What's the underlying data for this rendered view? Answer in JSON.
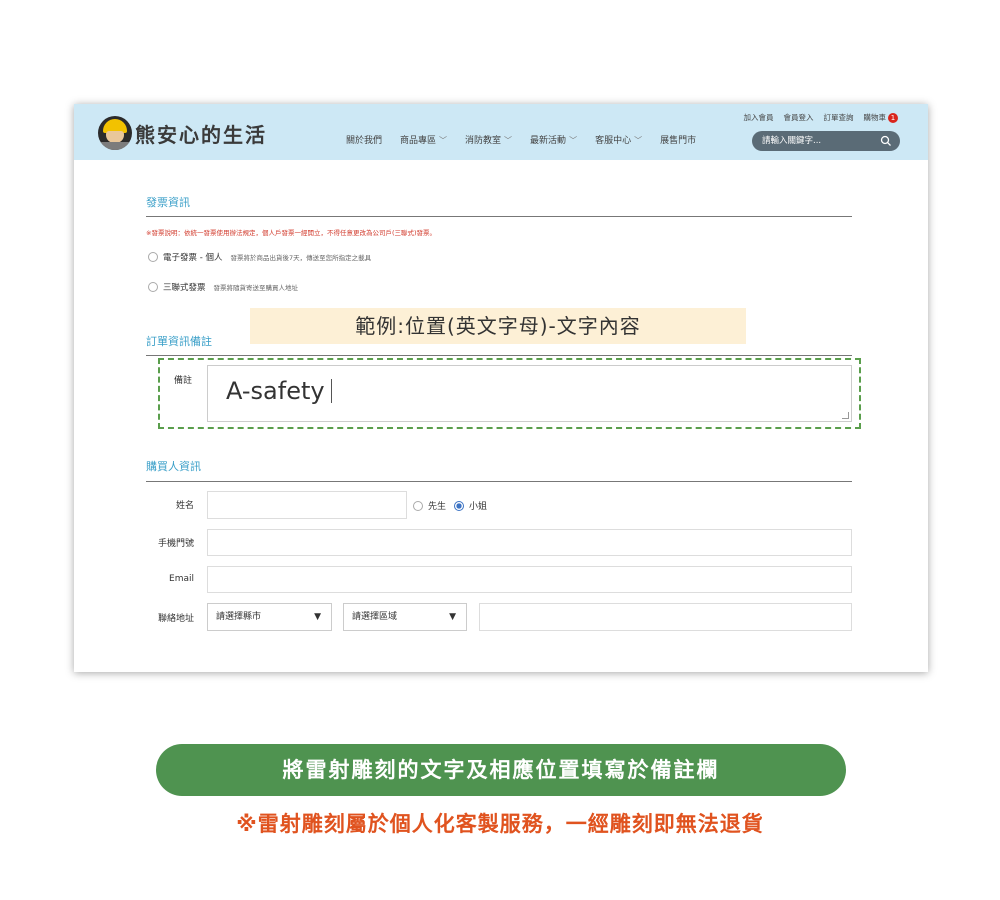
{
  "header": {
    "logo_text": "熊安心的生活",
    "top_links": [
      "加入會員",
      "會員登入",
      "訂單查詢",
      "購物車"
    ],
    "cart_count": "1",
    "nav": [
      {
        "label": "關於我們",
        "has_menu": false
      },
      {
        "label": "商品專區",
        "has_menu": true
      },
      {
        "label": "消防教室",
        "has_menu": true
      },
      {
        "label": "最新活動",
        "has_menu": true
      },
      {
        "label": "客服中心",
        "has_menu": true
      },
      {
        "label": "展售門市",
        "has_menu": false
      }
    ],
    "search_placeholder": "請輸入關鍵字..."
  },
  "invoice": {
    "title": "發票資訊",
    "note": "※發票說明：依統一發票使用辦法規定，個人戶發票一經開立，不得任意更改為公司戶(三聯式)發票。",
    "options": [
      {
        "label": "電子發票 - 個人",
        "desc": "發票將於商品出貨後7天，傳送至您所指定之載具"
      },
      {
        "label": "三聯式發票",
        "desc": "發票將隨貨寄送至購買人地址"
      }
    ]
  },
  "example_banner": "範例:位置(英文字母)-文字內容",
  "order_notes": {
    "title": "訂單資訊備註",
    "label": "備註",
    "value": "A-safety"
  },
  "buyer": {
    "title": "購買人資訊",
    "name_label": "姓名",
    "gender_options": [
      "先生",
      "小姐"
    ],
    "gender_selected": "小姐",
    "phone_label": "手機門號",
    "email_label": "Email",
    "address_label": "聯絡地址",
    "city_select": "請選擇縣市",
    "district_select": "請選擇區域"
  },
  "instruction": "將雷射雕刻的文字及相應位置填寫於備註欄",
  "warning": "※雷射雕刻屬於個人化客製服務，一經雕刻即無法退貨",
  "colors": {
    "header_bg": "#cde8f5",
    "section_title": "#3a9fc8",
    "cta_green": "#4f9350",
    "warning_orange": "#e0531f",
    "note_red": "#d23a2c",
    "dashed_green": "#5a9e4c"
  }
}
